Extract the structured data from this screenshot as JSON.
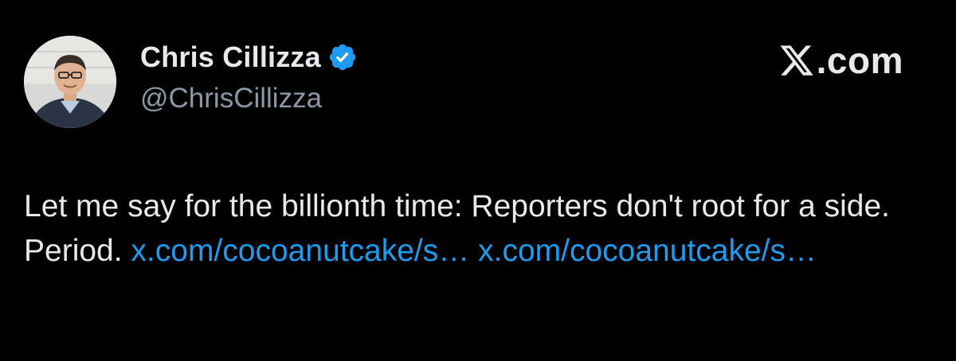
{
  "author": {
    "display_name": "Chris Cillizza",
    "handle": "@ChrisCillizza",
    "verified": true,
    "avatar_icon": "profile-photo"
  },
  "brand": {
    "logo_icon": "x-logo-icon",
    "text": ".com"
  },
  "tweet": {
    "text": "Let me say for the billionth time: Reporters don't root for a side. Period.",
    "links": [
      "x.com/cocoanutcake/s…",
      "x.com/cocoanutcake/s…"
    ]
  },
  "colors": {
    "background": "#000000",
    "text_primary": "#e7e9ea",
    "text_secondary": "#8b98a5",
    "link": "#1d9bf0",
    "verified": "#1d9bf0"
  }
}
